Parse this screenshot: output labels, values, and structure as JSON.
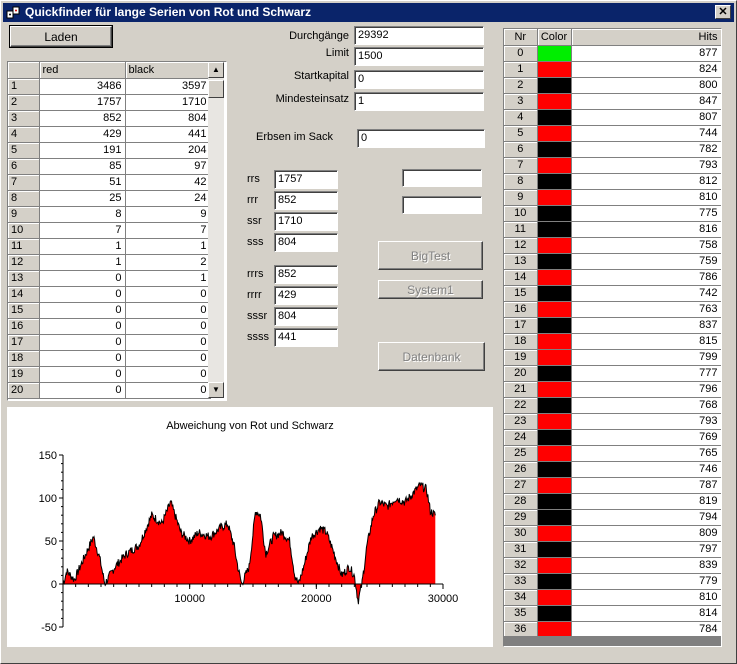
{
  "window": {
    "title": "Quickfinder für lange Serien von Rot und Schwarz",
    "close_glyph": "✕"
  },
  "buttons": {
    "laden": "Laden",
    "bigtest": "BigTest",
    "system1": "System1",
    "datenbank": "Datenbank"
  },
  "form": {
    "durchgaenge_label": "Durchgänge",
    "durchgaenge_value": "29392",
    "limit_label": "Limit",
    "limit_value": "1500",
    "startkapital_label": "Startkapital",
    "startkapital_value": "0",
    "mindesteinsatz_label": "Mindesteinsatz",
    "mindesteinsatz_value": "1",
    "erbsen_label": "Erbsen im Sack",
    "erbsen_value": "0",
    "extra1_value": "",
    "extra2_value": ""
  },
  "patterns": [
    {
      "label": "rrs",
      "value": "1757"
    },
    {
      "label": "rrr",
      "value": "852"
    },
    {
      "label": "ssr",
      "value": "1710"
    },
    {
      "label": "sss",
      "value": "804"
    },
    {
      "label": "rrrs",
      "value": "852"
    },
    {
      "label": "rrrr",
      "value": "429"
    },
    {
      "label": "sssr",
      "value": "804"
    },
    {
      "label": "ssss",
      "value": "441"
    }
  ],
  "series_table": {
    "columns": [
      "",
      "red",
      "black"
    ],
    "rows": [
      [
        "1",
        "3486",
        "3597"
      ],
      [
        "2",
        "1757",
        "1710"
      ],
      [
        "3",
        "852",
        "804"
      ],
      [
        "4",
        "429",
        "441"
      ],
      [
        "5",
        "191",
        "204"
      ],
      [
        "6",
        "85",
        "97"
      ],
      [
        "7",
        "51",
        "42"
      ],
      [
        "8",
        "25",
        "24"
      ],
      [
        "9",
        "8",
        "9"
      ],
      [
        "10",
        "7",
        "7"
      ],
      [
        "11",
        "1",
        "1"
      ],
      [
        "12",
        "1",
        "2"
      ],
      [
        "13",
        "0",
        "1"
      ],
      [
        "14",
        "0",
        "0"
      ],
      [
        "15",
        "0",
        "0"
      ],
      [
        "16",
        "0",
        "0"
      ],
      [
        "17",
        "0",
        "0"
      ],
      [
        "18",
        "0",
        "0"
      ],
      [
        "19",
        "0",
        "0"
      ],
      [
        "20",
        "0",
        "0"
      ]
    ],
    "scroll_up_glyph": "▲",
    "scroll_down_glyph": "▼"
  },
  "hits_table": {
    "columns": [
      "Nr",
      "Color",
      "Hits"
    ],
    "color_map": {
      "green": "#00ee00",
      "red": "#ff0000",
      "black": "#000000"
    },
    "rows": [
      {
        "nr": "0",
        "color": "green",
        "hits": "877"
      },
      {
        "nr": "1",
        "color": "red",
        "hits": "824"
      },
      {
        "nr": "2",
        "color": "black",
        "hits": "800"
      },
      {
        "nr": "3",
        "color": "red",
        "hits": "847"
      },
      {
        "nr": "4",
        "color": "black",
        "hits": "807"
      },
      {
        "nr": "5",
        "color": "red",
        "hits": "744"
      },
      {
        "nr": "6",
        "color": "black",
        "hits": "782"
      },
      {
        "nr": "7",
        "color": "red",
        "hits": "793"
      },
      {
        "nr": "8",
        "color": "black",
        "hits": "812"
      },
      {
        "nr": "9",
        "color": "red",
        "hits": "810"
      },
      {
        "nr": "10",
        "color": "black",
        "hits": "775"
      },
      {
        "nr": "11",
        "color": "black",
        "hits": "816"
      },
      {
        "nr": "12",
        "color": "red",
        "hits": "758"
      },
      {
        "nr": "13",
        "color": "black",
        "hits": "759"
      },
      {
        "nr": "14",
        "color": "red",
        "hits": "786"
      },
      {
        "nr": "15",
        "color": "black",
        "hits": "742"
      },
      {
        "nr": "16",
        "color": "red",
        "hits": "763"
      },
      {
        "nr": "17",
        "color": "black",
        "hits": "837"
      },
      {
        "nr": "18",
        "color": "red",
        "hits": "815"
      },
      {
        "nr": "19",
        "color": "red",
        "hits": "799"
      },
      {
        "nr": "20",
        "color": "black",
        "hits": "777"
      },
      {
        "nr": "21",
        "color": "red",
        "hits": "796"
      },
      {
        "nr": "22",
        "color": "black",
        "hits": "768"
      },
      {
        "nr": "23",
        "color": "red",
        "hits": "793"
      },
      {
        "nr": "24",
        "color": "black",
        "hits": "769"
      },
      {
        "nr": "25",
        "color": "red",
        "hits": "765"
      },
      {
        "nr": "26",
        "color": "black",
        "hits": "746"
      },
      {
        "nr": "27",
        "color": "red",
        "hits": "787"
      },
      {
        "nr": "28",
        "color": "black",
        "hits": "819"
      },
      {
        "nr": "29",
        "color": "black",
        "hits": "794"
      },
      {
        "nr": "30",
        "color": "red",
        "hits": "809"
      },
      {
        "nr": "31",
        "color": "black",
        "hits": "797"
      },
      {
        "nr": "32",
        "color": "red",
        "hits": "839"
      },
      {
        "nr": "33",
        "color": "black",
        "hits": "779"
      },
      {
        "nr": "34",
        "color": "red",
        "hits": "810"
      },
      {
        "nr": "35",
        "color": "black",
        "hits": "814"
      },
      {
        "nr": "36",
        "color": "red",
        "hits": "784"
      }
    ]
  },
  "chart_data": {
    "type": "area",
    "title": "Abweichung von Rot und Schwarz",
    "xlabel": "",
    "ylabel": "",
    "xlim": [
      0,
      29392
    ],
    "ylim": [
      -50,
      150
    ],
    "xticks": [
      "10000",
      "20000",
      "30000"
    ],
    "yticks": [
      "150",
      "100",
      "50",
      "0",
      "-50"
    ],
    "grid": false,
    "fill_color": "#ff0000",
    "line_color": "#000000",
    "series": [
      {
        "x": [
          0,
          300,
          900,
          1500,
          2400,
          2900,
          3300,
          4100,
          5000,
          6000,
          7000,
          7800,
          8500,
          9300,
          10000,
          10700,
          11600,
          12400,
          13000,
          13500,
          13800,
          14100,
          14700,
          15200,
          15600,
          16000,
          16600,
          17300,
          17900,
          18300,
          18600,
          19000,
          19600,
          20300,
          20800,
          21300,
          22000,
          22600,
          23000,
          23300,
          23600,
          24000,
          24500,
          25000,
          25600,
          26300,
          27000,
          27600,
          28200,
          28700,
          29000,
          29392
        ],
        "values": [
          0,
          15,
          5,
          25,
          55,
          30,
          0,
          20,
          35,
          45,
          80,
          70,
          95,
          60,
          50,
          60,
          55,
          65,
          70,
          45,
          20,
          0,
          20,
          85,
          80,
          35,
          55,
          60,
          50,
          10,
          0,
          20,
          55,
          65,
          60,
          40,
          10,
          20,
          10,
          -20,
          0,
          45,
          80,
          95,
          90,
          100,
          95,
          105,
          115,
          110,
          85,
          80
        ]
      }
    ]
  }
}
